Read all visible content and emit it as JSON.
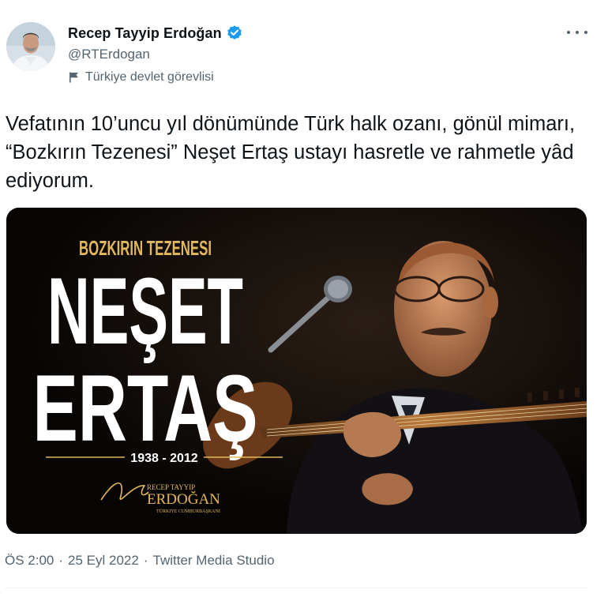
{
  "author": {
    "display_name": "Recep Tayyip Erdoğan",
    "handle": "@RTErdogan",
    "label": "Türkiye devlet görevlisi",
    "verified_color": "#1d9bf0"
  },
  "tweet": {
    "text": "Vefatının 10’uncu yıl dönümünde Türk halk ozanı, gönül mimarı, “Bozkırın Tezenesi” Neşet Ertaş ustayı hasretle ve rahmetle yâd ediyorum."
  },
  "media": {
    "subtitle": "BOZKIRIN TEZENESI",
    "name_line1": "NEŞET",
    "name_line2": "ERTAŞ",
    "years": "1938 - 2012",
    "signature_small": "RECEP TAYYIP",
    "signature_name": "ERDOĞAN",
    "signature_role": "TÜRKIYE CUMHURBAŞKANI"
  },
  "meta": {
    "time": "ÖS 2:00",
    "date": "25 Eyl 2022",
    "source": "Twitter Media Studio"
  },
  "colors": {
    "text_primary": "#0f1419",
    "text_secondary": "#536471",
    "accent_gold": "#e3b75b"
  }
}
